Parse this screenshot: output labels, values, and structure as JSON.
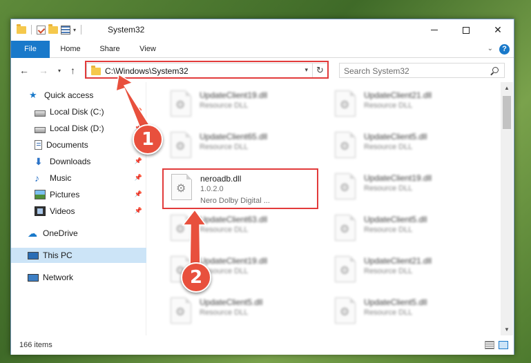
{
  "window": {
    "title": "System32"
  },
  "ribbon": {
    "tabs": [
      "File",
      "Home",
      "Share",
      "View"
    ]
  },
  "address": {
    "path": "C:\\Windows\\System32"
  },
  "search": {
    "placeholder": "Search System32"
  },
  "sidebar": {
    "items": [
      {
        "label": "Quick access",
        "icon": "star-icon"
      },
      {
        "label": "Local Disk (C:)",
        "icon": "disk-icon"
      },
      {
        "label": "Local Disk (D:)",
        "icon": "disk-icon"
      },
      {
        "label": "Documents",
        "icon": "documents-icon"
      },
      {
        "label": "Downloads",
        "icon": "downloads-icon"
      },
      {
        "label": "Music",
        "icon": "music-icon"
      },
      {
        "label": "Pictures",
        "icon": "pictures-icon"
      },
      {
        "label": "Videos",
        "icon": "videos-icon"
      },
      {
        "label": "OneDrive",
        "icon": "onedrive-icon"
      },
      {
        "label": "This PC",
        "icon": "this-pc-icon"
      },
      {
        "label": "Network",
        "icon": "network-icon"
      }
    ]
  },
  "files": {
    "left": [
      {
        "name": "UpdateClient19.dll",
        "type": "Resource DLL"
      },
      {
        "name": "UpdateClient65.dll",
        "type": "Resource DLL"
      },
      {
        "name": "neroadb.dll",
        "version": "1.0.2.0",
        "desc": "Nero Dolby Digital ..."
      },
      {
        "name": "UpdateClient63.dll",
        "type": "Resource DLL"
      },
      {
        "name": "UpdateClient19.dll",
        "type": "Resource DLL"
      },
      {
        "name": "UpdateClient5.dll",
        "type": "Resource DLL"
      }
    ],
    "right": [
      {
        "name": "UpdateClient21.dll",
        "type": "Resource DLL"
      },
      {
        "name": "UpdateClient5.dll",
        "type": "Resource DLL"
      },
      {
        "name": "UpdateClient19.dll",
        "type": "Resource DLL"
      },
      {
        "name": "UpdateClient5.dll",
        "type": "Resource DLL"
      },
      {
        "name": "UpdateClient21.dll",
        "type": "Resource DLL"
      },
      {
        "name": "UpdateClient5.dll",
        "type": "Resource DLL"
      }
    ]
  },
  "status": {
    "item_count": "166 items"
  },
  "callouts": {
    "one": "1",
    "two": "2"
  },
  "colors": {
    "accent": "#1979ca",
    "annotation": "#e23a3a",
    "callout": "#e8503d"
  }
}
